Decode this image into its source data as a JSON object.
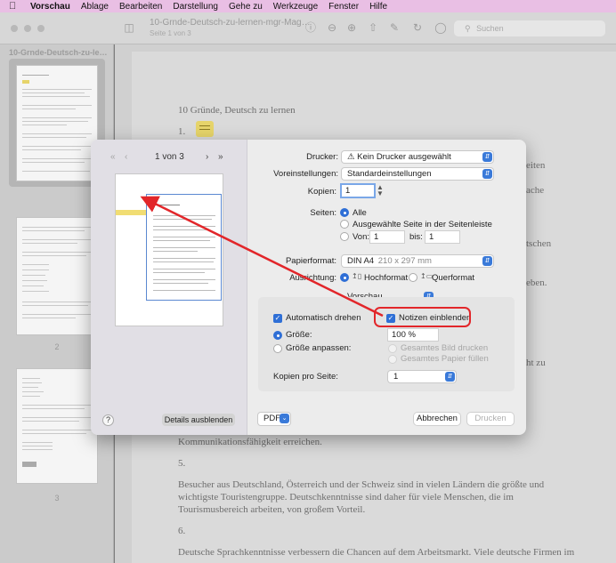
{
  "menubar": {
    "app": "Vorschau",
    "items": [
      "Ablage",
      "Bearbeiten",
      "Darstellung",
      "Gehe zu",
      "Werkzeuge",
      "Fenster",
      "Hilfe"
    ]
  },
  "toolbar": {
    "title": "10-Grnde-Deutsch-zu-lernen-mgr-Mag…",
    "subtitle": "Seite 1 von 3",
    "search_placeholder": "Suchen"
  },
  "sidebar": {
    "title": "10-Grnde-Deutsch-zu-le…",
    "pages": [
      "1",
      "2",
      "3"
    ],
    "selected_page": "1"
  },
  "document": {
    "heading": "10 Gründe, Deutsch zu lernen",
    "item1": "1.",
    "right_fragments": [
      "eiten",
      "ache",
      "tschen",
      "eben.",
      "ht zu"
    ],
    "para_comm": "Kommunikationsfähigkeit erreichen.",
    "item5": "5.",
    "para5_line1": "Besucher aus Deutschland, Österreich und der Schweiz sind in vielen Ländern die größte und",
    "para5_line2": "wichtigste Touristengruppe. Deutschkenntnisse sind daher für viele Menschen, die im",
    "para5_line3": "Tourismusbereich arbeiten, von großem Vorteil.",
    "item6": "6.",
    "para6_line1": "Deutsche Sprachkenntnisse verbessern die Chancen auf dem Arbeitsmarkt. Viele deutsche Firmen im"
  },
  "dialog": {
    "page_info": "1 von 3",
    "printer_label": "Drucker:",
    "printer_value": "Kein Drucker ausgewählt",
    "presets_label": "Voreinstellungen:",
    "presets_value": "Standardeinstellungen",
    "copies_label": "Kopien:",
    "copies_value": "1",
    "pages_label": "Seiten:",
    "pages_all": "Alle",
    "pages_selected": "Ausgewählte Seite in der Seitenleiste",
    "pages_from": "Von:",
    "pages_from_value": "1",
    "pages_to": "bis:",
    "pages_to_value": "1",
    "paper_label": "Papierformat:",
    "paper_value": "DIN A4",
    "paper_size": "210 x 297 mm",
    "orientation_label": "Ausrichtung:",
    "portrait": "Hochformat",
    "landscape": "Querformat",
    "app_section": "Vorschau",
    "auto_rotate": "Automatisch drehen",
    "show_notes": "Notizen einblenden",
    "size_label": "Größe:",
    "size_value": "100 %",
    "fit_label": "Größe anpassen:",
    "fit_print_all": "Gesamtes Bild drucken",
    "fit_fill_paper": "Gesamtes Papier füllen",
    "pages_per_sheet_label": "Kopien pro Seite:",
    "pages_per_sheet_value": "1",
    "help": "?",
    "hide_details": "Details ausblenden",
    "pdf": "PDF",
    "cancel": "Abbrechen",
    "print": "Drucken"
  },
  "colors": {
    "menubar": "#e9bfe4",
    "accent": "#2f6fd6",
    "annotation_red": "#e2262a",
    "note_yellow": "#e6d46a"
  }
}
